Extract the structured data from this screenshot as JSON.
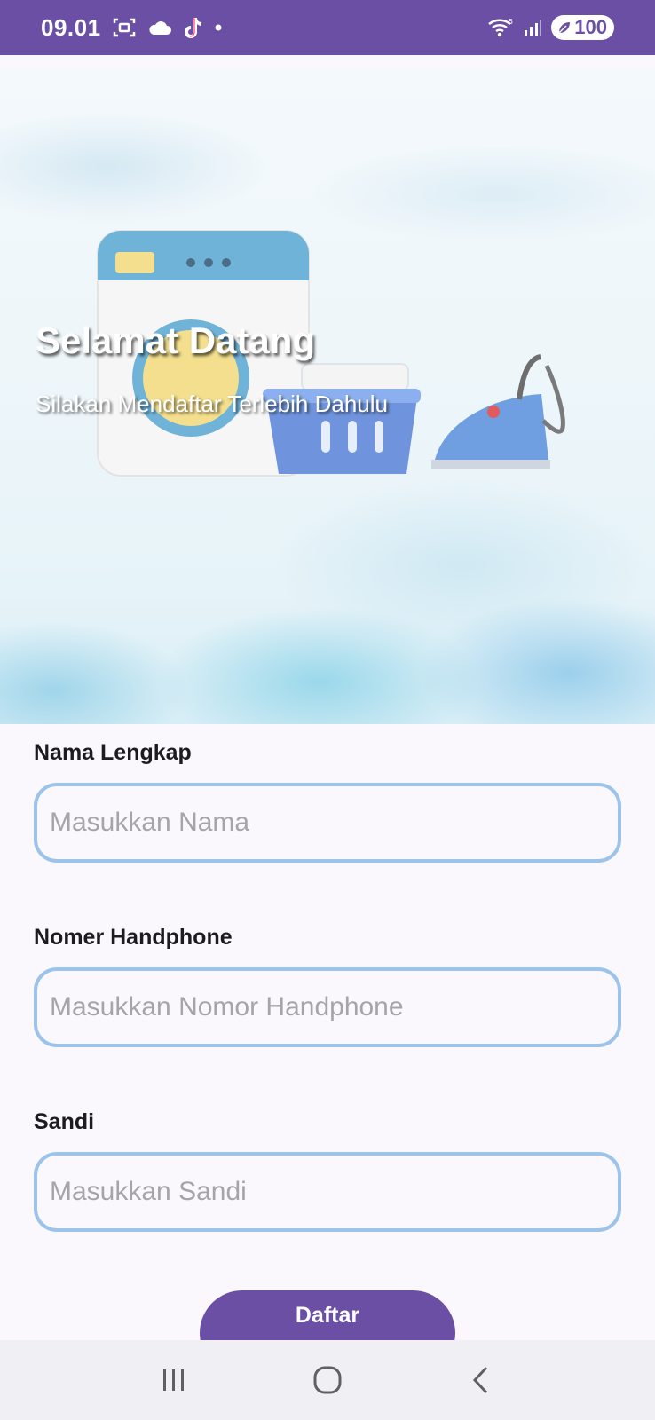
{
  "status_bar": {
    "time": "09.01",
    "battery": "100",
    "icons": [
      "screenshot-icon",
      "cloud-icon",
      "tiktok-icon",
      "dot-icon",
      "wifi-icon",
      "signal-icon",
      "battery-saver-icon"
    ]
  },
  "hero": {
    "title": "Selamat Datang",
    "subtitle": "Silakan Mendaftar Terlebih Dahulu",
    "illustration": "laundry-illustration"
  },
  "form": {
    "fields": [
      {
        "label": "Nama Lengkap",
        "placeholder": "Masukkan Nama",
        "value": ""
      },
      {
        "label": "Nomer Handphone",
        "placeholder": "Masukkan Nomor Handphone",
        "value": ""
      },
      {
        "label": "Sandi",
        "placeholder": "Masukkan Sandi",
        "value": ""
      }
    ],
    "submit_label": "Daftar"
  },
  "nav_bar": {
    "buttons": [
      "recent-apps-icon",
      "home-icon",
      "back-icon"
    ]
  },
  "colors": {
    "primary": "#6a4fa5",
    "input_border": "#9cc3ea",
    "background": "#fbf8fd",
    "nav_bar": "#f0eff3"
  }
}
